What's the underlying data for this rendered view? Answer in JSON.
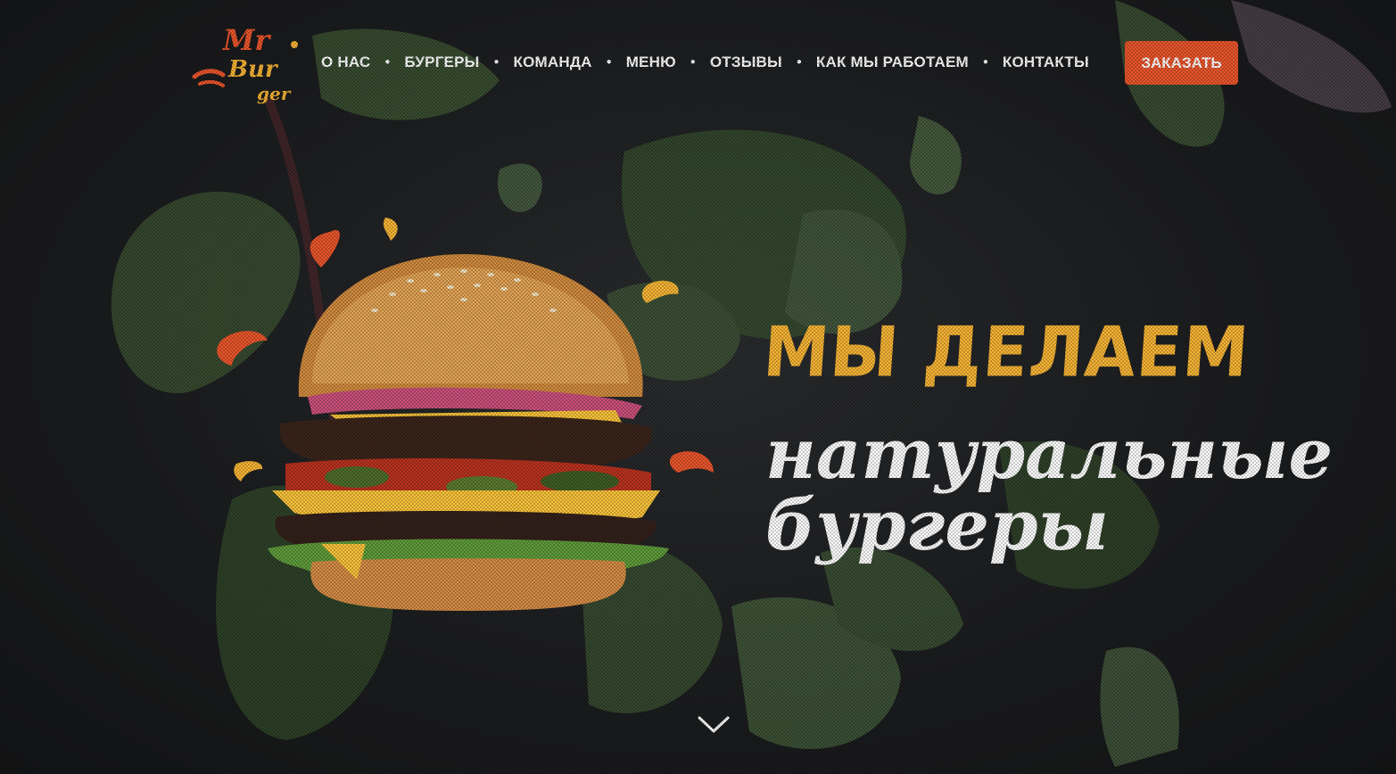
{
  "brand": {
    "logo_line1": "Mr",
    "logo_line2": "Bur",
    "logo_line3": "ger"
  },
  "nav": {
    "items": [
      {
        "label": "О НАС"
      },
      {
        "label": "БУРГЕРЫ"
      },
      {
        "label": "КОМАНДА"
      },
      {
        "label": "МЕНЮ"
      },
      {
        "label": "ОТЗЫВЫ"
      },
      {
        "label": "КАК МЫ РАБОТАЕМ"
      },
      {
        "label": "КОНТАКТЫ"
      }
    ],
    "order_label": "ЗАКАЗАТЬ"
  },
  "hero": {
    "headline_top": "МЫ ДЕЛАЕМ",
    "headline_line2": "натуральные",
    "headline_line3": "бургеры"
  },
  "colors": {
    "accent": "#e8552c",
    "headline_yellow": "#f5b335",
    "background": "#1c1d1f"
  },
  "icons": {
    "scroll": "chevron-down-icon"
  }
}
